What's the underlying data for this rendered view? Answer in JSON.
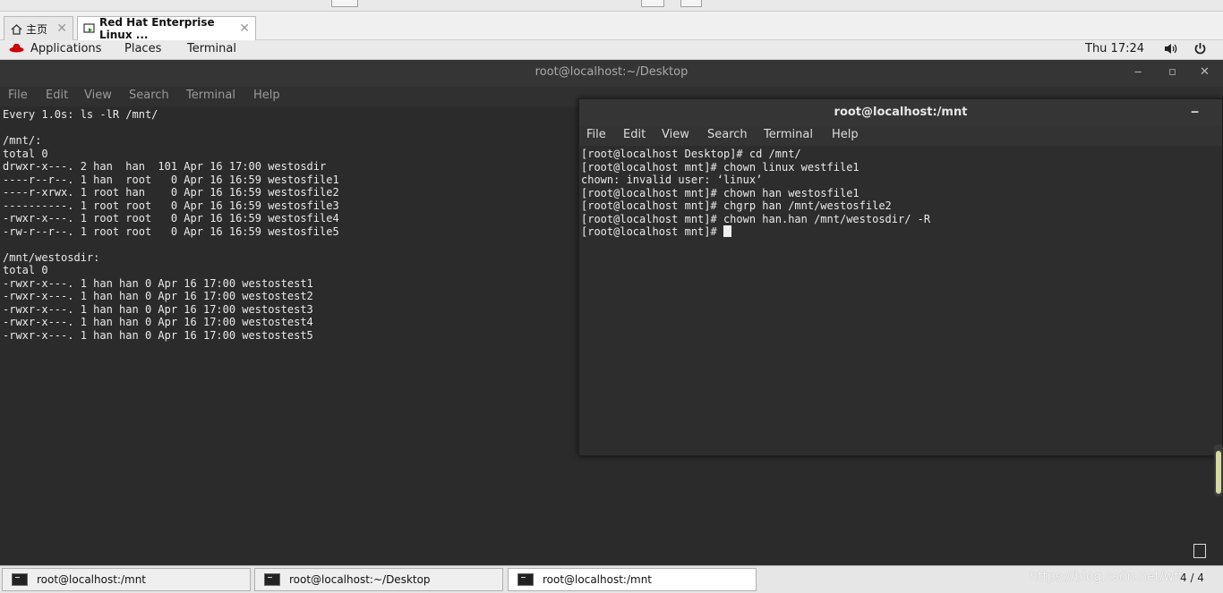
{
  "vm_tabs": [
    {
      "label": "主页",
      "active": false
    },
    {
      "label": "Red Hat Enterprise Linux ...",
      "active": true
    }
  ],
  "gnome_bar": {
    "applications": "Applications",
    "places": "Places",
    "terminal": "Terminal",
    "clock": "Thu 17:24"
  },
  "main_window": {
    "title": "root@localhost:~/Desktop",
    "menu": [
      "File",
      "Edit",
      "View",
      "Search",
      "Terminal",
      "Help"
    ],
    "output": "Every 1.0s: ls -lR /mnt/\n\n/mnt/:\ntotal 0\ndrwxr-x---. 2 han  han  101 Apr 16 17:00 westosdir\n----r--r--. 1 han  root   0 Apr 16 16:59 westosfile1\n----r-xrwx. 1 root han    0 Apr 16 16:59 westosfile2\n----------. 1 root root   0 Apr 16 16:59 westosfile3\n-rwxr-x---. 1 root root   0 Apr 16 16:59 westosfile4\n-rw-r--r--. 1 root root   0 Apr 16 16:59 westosfile5\n\n/mnt/westosdir:\ntotal 0\n-rwxr-x---. 1 han han 0 Apr 16 17:00 westostest1\n-rwxr-x---. 1 han han 0 Apr 16 17:00 westostest2\n-rwxr-x---. 1 han han 0 Apr 16 17:00 westostest3\n-rwxr-x---. 1 han han 0 Apr 16 17:00 westostest4\n-rwxr-x---. 1 han han 0 Apr 16 17:00 westostest5"
  },
  "sub_window": {
    "title": "root@localhost:/mnt",
    "menu": [
      "File",
      "Edit",
      "View",
      "Search",
      "Terminal",
      "Help"
    ],
    "output": "[root@localhost Desktop]# cd /mnt/\n[root@localhost mnt]# chown linux westfile1\nchown: invalid user: ‘linux’\n[root@localhost mnt]# chown han westosfile1\n[root@localhost mnt]# chgrp han /mnt/westosfile2\n[root@localhost mnt]# chown han.han /mnt/westosdir/ -R\n[root@localhost mnt]# "
  },
  "taskbar": {
    "items": [
      {
        "label": "root@localhost:/mnt",
        "active": false
      },
      {
        "label": "root@localhost:~/Desktop",
        "active": false
      },
      {
        "label": "root@localhost:/mnt",
        "active": true
      }
    ],
    "pager": "4 / 4",
    "watermark": "https://blog.csdn.net/wft"
  },
  "colors": {
    "terminal_bg": "#2b2b2b",
    "terminal_fg": "#eaeaea",
    "redhat": "#cc0000"
  }
}
